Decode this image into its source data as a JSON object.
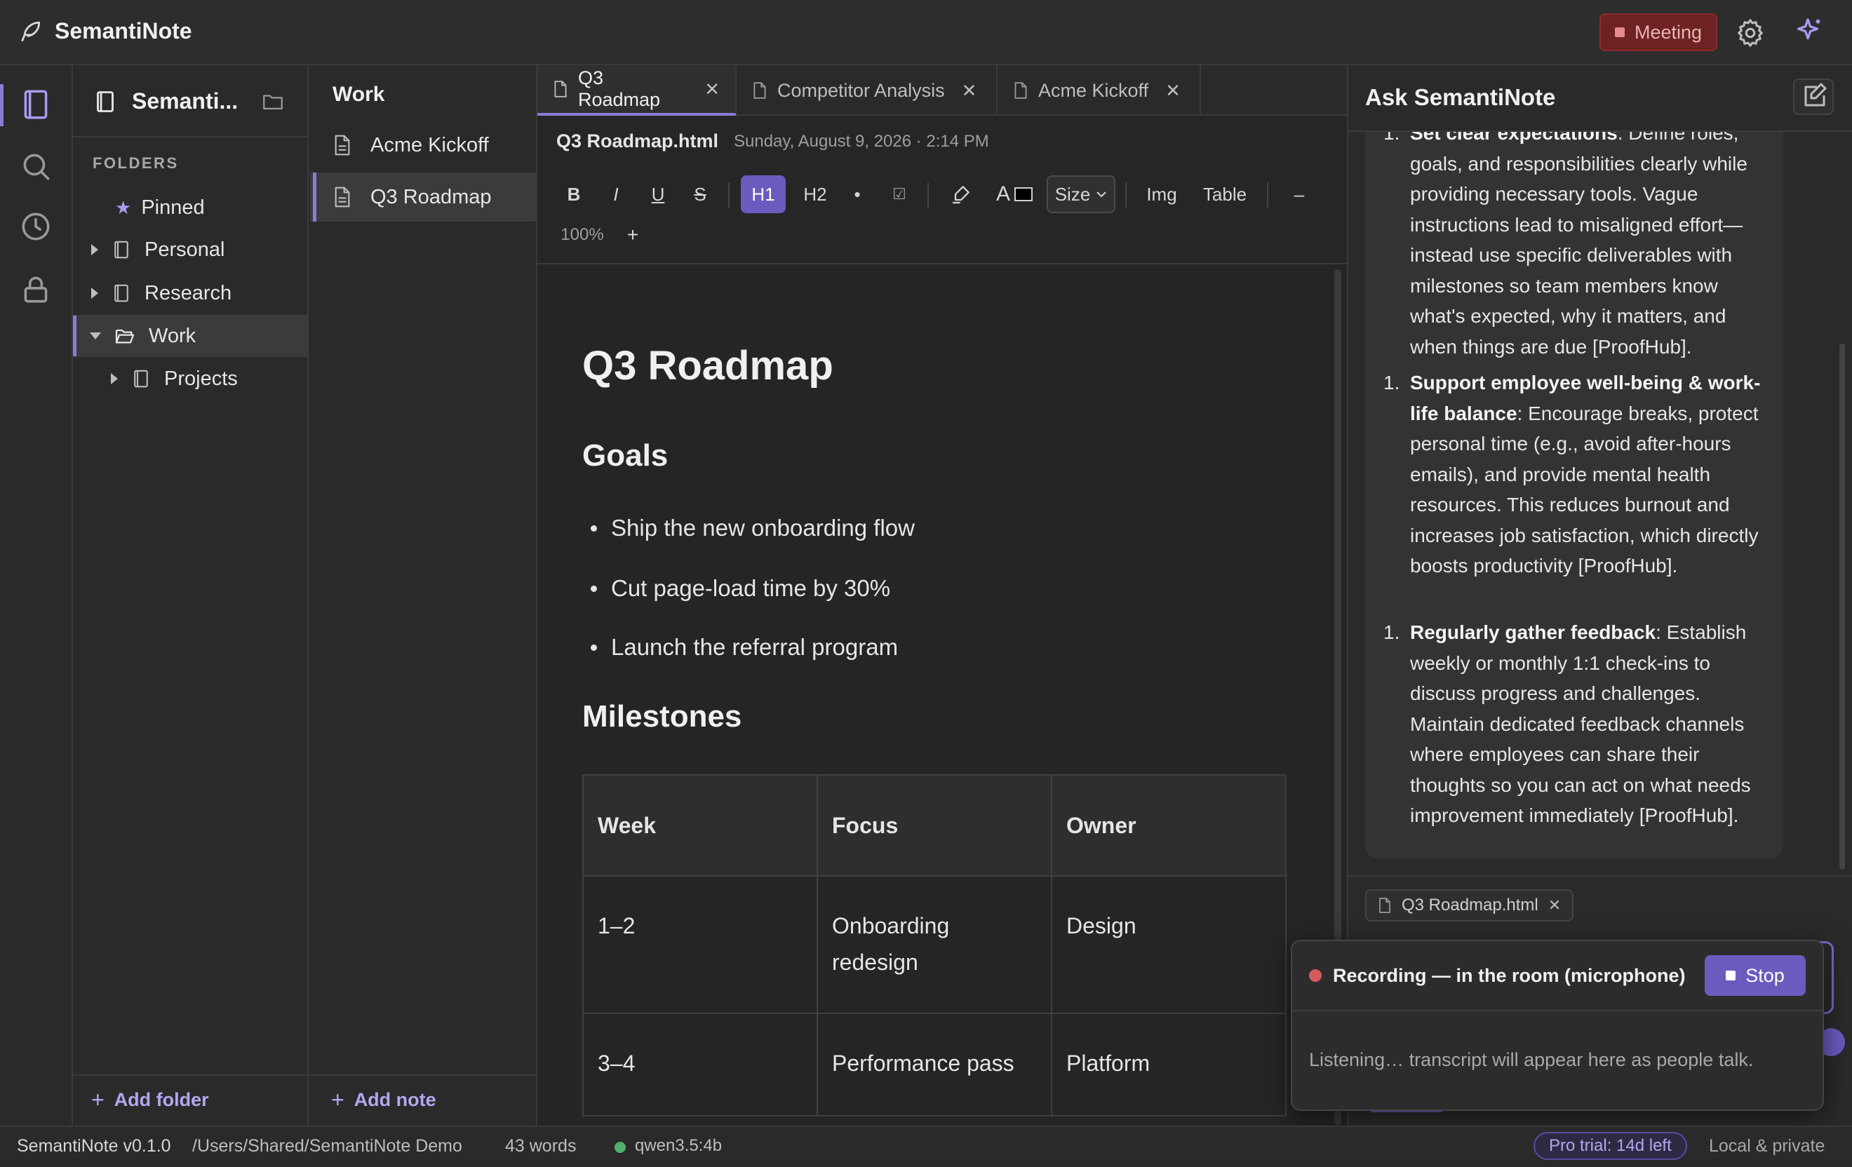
{
  "app": {
    "title": "SemantiNote"
  },
  "titlebar": {
    "meeting_label": "Meeting",
    "accent_color": "#8a7bd6",
    "recording_color": "#d45b5b"
  },
  "rail": {
    "icons": [
      "notebook-icon",
      "search-icon",
      "history-icon",
      "lock-icon"
    ]
  },
  "folders": {
    "vault_name": "Semanti...",
    "section_label": "FOLDERS",
    "items": [
      {
        "label": "Pinned",
        "icon": "star-icon"
      },
      {
        "label": "Personal",
        "icon": "notebook-icon"
      },
      {
        "label": "Research",
        "icon": "notebook-icon"
      },
      {
        "label": "Work",
        "icon": "folder-open-icon"
      },
      {
        "label": "Projects",
        "icon": "notebook-icon"
      }
    ],
    "add_label": "Add folder"
  },
  "notes": {
    "title": "Work",
    "items": [
      {
        "label": "Acme Kickoff"
      },
      {
        "label": "Q3 Roadmap"
      }
    ],
    "add_label": "Add note"
  },
  "editor": {
    "tabs": [
      {
        "label": "Q3 Roadmap"
      },
      {
        "label": "Competitor Analysis"
      },
      {
        "label": "Acme Kickoff"
      }
    ],
    "file_name": "Q3 Roadmap.html",
    "file_date": "Sunday, August 9, 2026 · 2:14 PM",
    "toolbar": {
      "bold": "B",
      "italic": "I",
      "underline": "U",
      "strike": "S",
      "h1": "H1",
      "h2": "H2",
      "bullet": "•",
      "checkbox": "☑",
      "font_color": "A",
      "size": "Size",
      "image": "Img",
      "table": "Table",
      "zoom_out": "–",
      "zoom": "100%",
      "zoom_in": "+"
    },
    "doc": {
      "title": "Q3 Roadmap",
      "goals_heading": "Goals",
      "goals": [
        "Ship the new onboarding flow",
        "Cut page-load time by 30%",
        "Launch the referral program"
      ],
      "milestones_heading": "Milestones",
      "table": {
        "headers": [
          "Week",
          "Focus",
          "Owner"
        ],
        "rows": [
          [
            "1–2",
            "Onboarding redesign",
            "Design"
          ],
          [
            "3–4",
            "Performance pass",
            "Platform"
          ]
        ]
      }
    }
  },
  "chat": {
    "title": "Ask SemantiNote",
    "items": [
      {
        "num": "1.",
        "bold": "Set clear expectations",
        "text": ": Define roles, goals, and responsibilities clearly while providing necessary tools. Vague instructions lead to misaligned effort—instead use specific deliverables with milestones so team members know what's expected, why it matters, and when things are due [ProofHub]."
      },
      {
        "num": "1.",
        "bold": "Support employee well-being & work-life balance",
        "text": ": Encourage breaks, protect personal time (e.g., avoid after-hours emails), and provide mental health resources. This reduces burnout and increases job satisfaction, which directly boosts productivity [ProofHub]."
      },
      {
        "num": "1.",
        "bold": "Regularly gather feedback",
        "text": ": Establish weekly or monthly 1:1 check-ins to discuss progress and challenges. Maintain dedicated feedback channels where employees can share their thoughts so you can act on what needs improvement immediately [ProofHub]."
      }
    ],
    "context_chip": "Q3 Roadmap.html"
  },
  "recording": {
    "title": "Recording — in the room (microphone)",
    "stop_label": "Stop",
    "status": "Listening… transcript will appear here as people talk."
  },
  "statusbar": {
    "version": "SemantiNote v0.1.0",
    "path": "/Users/Shared/SemantiNote Demo",
    "word_count": "43 words",
    "model": "qwen3.5:4b",
    "trial": "Pro trial: 14d left",
    "privacy": "Local & private"
  }
}
